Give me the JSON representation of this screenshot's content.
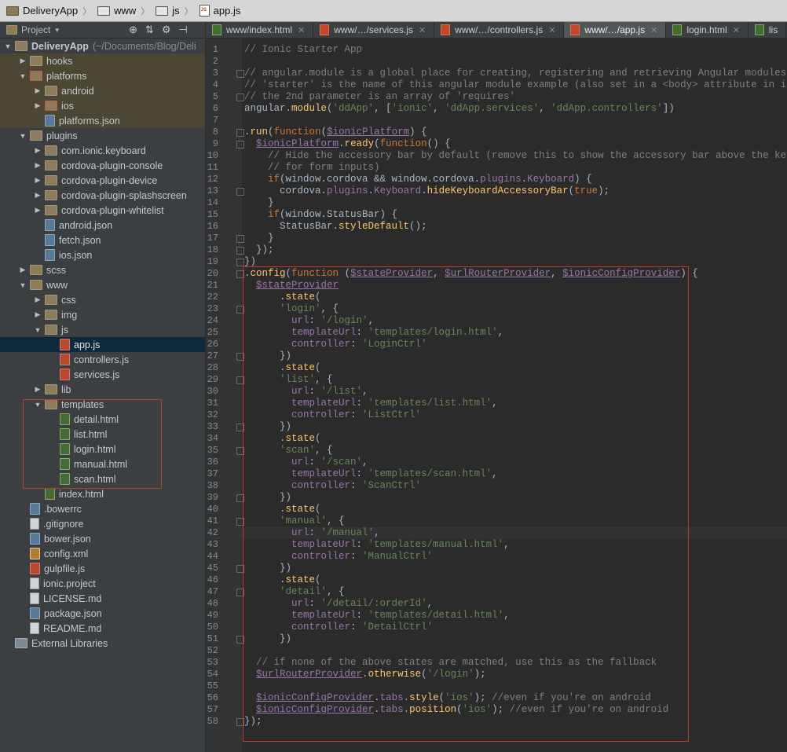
{
  "breadcrumbs": [
    "DeliveryApp",
    "www",
    "js",
    "app.js"
  ],
  "project_panel": {
    "label": "Project"
  },
  "tabs": [
    {
      "label": "www/index.html",
      "type": "html",
      "active": false
    },
    {
      "label": "www/…/services.js",
      "type": "js",
      "active": false
    },
    {
      "label": "www/…/controllers.js",
      "type": "js",
      "active": false
    },
    {
      "label": "www/…/app.js",
      "type": "js",
      "active": true
    },
    {
      "label": "login.html",
      "type": "html",
      "active": false
    },
    {
      "label": "lis",
      "type": "html",
      "active": false
    }
  ],
  "tree": [
    {
      "label": "DeliveryApp",
      "suffix": "(~/Documents/Blog/Deli",
      "icon": "folder",
      "indent": 0,
      "expanded": true,
      "bold": true
    },
    {
      "label": "hooks",
      "icon": "folder",
      "indent": 1,
      "expanded": false,
      "highlight": true
    },
    {
      "label": "platforms",
      "icon": "redfolder",
      "indent": 1,
      "expanded": true,
      "highlight": true
    },
    {
      "label": "android",
      "icon": "folder",
      "indent": 2,
      "expanded": false,
      "highlight": true
    },
    {
      "label": "ios",
      "icon": "redfolder",
      "indent": 2,
      "expanded": false,
      "highlight": true
    },
    {
      "label": "platforms.json",
      "icon": "json",
      "indent": 2,
      "highlight": true
    },
    {
      "label": "plugins",
      "icon": "folder",
      "indent": 1,
      "expanded": true
    },
    {
      "label": "com.ionic.keyboard",
      "icon": "folder",
      "indent": 2,
      "expanded": false
    },
    {
      "label": "cordova-plugin-console",
      "icon": "folder",
      "indent": 2,
      "expanded": false
    },
    {
      "label": "cordova-plugin-device",
      "icon": "folder",
      "indent": 2,
      "expanded": false
    },
    {
      "label": "cordova-plugin-splashscreen",
      "icon": "folder",
      "indent": 2,
      "expanded": false
    },
    {
      "label": "cordova-plugin-whitelist",
      "icon": "folder",
      "indent": 2,
      "expanded": false
    },
    {
      "label": "android.json",
      "icon": "json",
      "indent": 2
    },
    {
      "label": "fetch.json",
      "icon": "json",
      "indent": 2
    },
    {
      "label": "ios.json",
      "icon": "json",
      "indent": 2
    },
    {
      "label": "scss",
      "icon": "folder",
      "indent": 1,
      "expanded": false
    },
    {
      "label": "www",
      "icon": "folder",
      "indent": 1,
      "expanded": true
    },
    {
      "label": "css",
      "icon": "folder",
      "indent": 2,
      "expanded": false
    },
    {
      "label": "img",
      "icon": "folder",
      "indent": 2,
      "expanded": false
    },
    {
      "label": "js",
      "icon": "folder",
      "indent": 2,
      "expanded": true
    },
    {
      "label": "app.js",
      "icon": "jsf",
      "indent": 3,
      "selected": true
    },
    {
      "label": "controllers.js",
      "icon": "jsf",
      "indent": 3
    },
    {
      "label": "services.js",
      "icon": "jsf",
      "indent": 3
    },
    {
      "label": "lib",
      "icon": "folder",
      "indent": 2,
      "expanded": false
    },
    {
      "label": "templates",
      "icon": "folder",
      "indent": 2,
      "expanded": true
    },
    {
      "label": "detail.html",
      "icon": "htm",
      "indent": 3
    },
    {
      "label": "list.html",
      "icon": "htm",
      "indent": 3
    },
    {
      "label": "login.html",
      "icon": "htm",
      "indent": 3
    },
    {
      "label": "manual.html",
      "icon": "htm",
      "indent": 3
    },
    {
      "label": "scan.html",
      "icon": "htm",
      "indent": 3
    },
    {
      "label": "index.html",
      "icon": "htm",
      "indent": 2
    },
    {
      "label": ".bowerrc",
      "icon": "json",
      "indent": 1
    },
    {
      "label": ".gitignore",
      "icon": "txt",
      "indent": 1
    },
    {
      "label": "bower.json",
      "icon": "json",
      "indent": 1
    },
    {
      "label": "config.xml",
      "icon": "xml",
      "indent": 1
    },
    {
      "label": "gulpfile.js",
      "icon": "jsf",
      "indent": 1
    },
    {
      "label": "ionic.project",
      "icon": "txt",
      "indent": 1
    },
    {
      "label": "LICENSE.md",
      "icon": "txt",
      "indent": 1
    },
    {
      "label": "package.json",
      "icon": "json",
      "indent": 1
    },
    {
      "label": "README.md",
      "icon": "txt",
      "indent": 1
    },
    {
      "label": "External Libraries",
      "icon": "ext",
      "indent": 0
    }
  ],
  "code_lines": [
    "// Ionic Starter App",
    "",
    "// angular.module is a global place for creating, registering and retrieving Angular modules",
    "// 'starter' is the name of this angular module example (also set in a <body> attribute in index.ht",
    "// the 2nd parameter is an array of 'requires'",
    "angular.module('ddApp', ['ionic', 'ddApp.services', 'ddApp.controllers'])",
    "",
    ".run(function($ionicPlatform) {",
    "  $ionicPlatform.ready(function() {",
    "    // Hide the accessory bar by default (remove this to show the accessory bar above the keyboard",
    "    // for form inputs)",
    "    if(window.cordova && window.cordova.plugins.Keyboard) {",
    "      cordova.plugins.Keyboard.hideKeyboardAccessoryBar(true);",
    "    }",
    "    if(window.StatusBar) {",
    "      StatusBar.styleDefault();",
    "    }",
    "  });",
    "})",
    ".config(function ($stateProvider, $urlRouterProvider, $ionicConfigProvider) {",
    "  $stateProvider",
    "      .state(",
    "      'login', {",
    "        url: '/login',",
    "        templateUrl: 'templates/login.html',",
    "        controller: 'LoginCtrl'",
    "      })",
    "      .state(",
    "      'list', {",
    "        url: '/list',",
    "        templateUrl: 'templates/list.html',",
    "        controller: 'ListCtrl'",
    "      })",
    "      .state(",
    "      'scan', {",
    "        url: '/scan',",
    "        templateUrl: 'templates/scan.html',",
    "        controller: 'ScanCtrl'",
    "      })",
    "      .state(",
    "      'manual', {",
    "        url: '/manual',",
    "        templateUrl: 'templates/manual.html',",
    "        controller: 'ManualCtrl'",
    "      })",
    "      .state(",
    "      'detail', {",
    "        url: '/detail/:orderId',",
    "        templateUrl: 'templates/detail.html',",
    "        controller: 'DetailCtrl'",
    "      })",
    "",
    "  // if none of the above states are matched, use this as the fallback",
    "  $urlRouterProvider.otherwise('/login');",
    "",
    "  $ionicConfigProvider.tabs.style('ios'); //even if you're on android",
    "  $ionicConfigProvider.tabs.position('ios'); //even if you're on android",
    "});"
  ],
  "colors": {
    "highlight_box": "#c0392b",
    "keyword": "#cc7832",
    "string": "#6a8759",
    "comment": "#808080",
    "function": "#ffc66d",
    "variable": "#9876aa"
  }
}
